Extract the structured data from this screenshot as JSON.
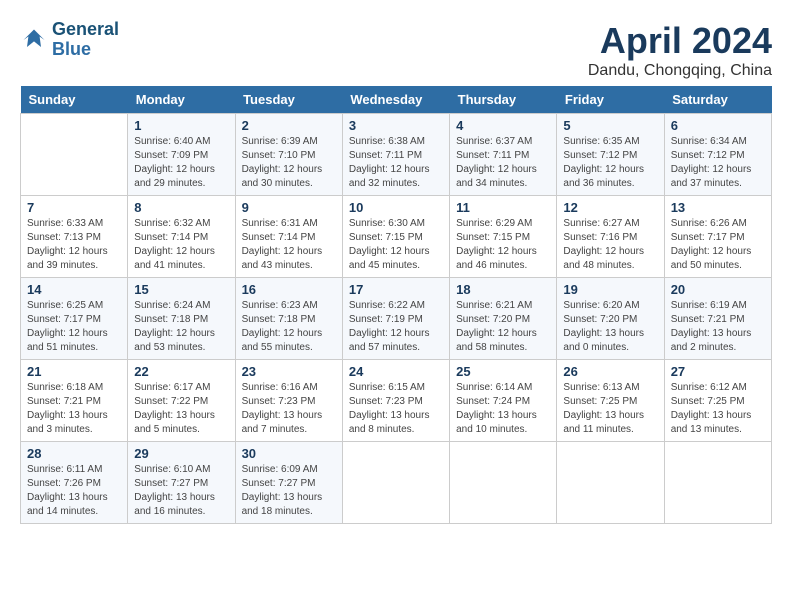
{
  "header": {
    "logo_line1": "General",
    "logo_line2": "Blue",
    "month_year": "April 2024",
    "location": "Dandu, Chongqing, China"
  },
  "weekdays": [
    "Sunday",
    "Monday",
    "Tuesday",
    "Wednesday",
    "Thursday",
    "Friday",
    "Saturday"
  ],
  "weeks": [
    [
      {
        "day": "",
        "sunrise": "",
        "sunset": "",
        "daylight": ""
      },
      {
        "day": "1",
        "sunrise": "Sunrise: 6:40 AM",
        "sunset": "Sunset: 7:09 PM",
        "daylight": "Daylight: 12 hours and 29 minutes."
      },
      {
        "day": "2",
        "sunrise": "Sunrise: 6:39 AM",
        "sunset": "Sunset: 7:10 PM",
        "daylight": "Daylight: 12 hours and 30 minutes."
      },
      {
        "day": "3",
        "sunrise": "Sunrise: 6:38 AM",
        "sunset": "Sunset: 7:11 PM",
        "daylight": "Daylight: 12 hours and 32 minutes."
      },
      {
        "day": "4",
        "sunrise": "Sunrise: 6:37 AM",
        "sunset": "Sunset: 7:11 PM",
        "daylight": "Daylight: 12 hours and 34 minutes."
      },
      {
        "day": "5",
        "sunrise": "Sunrise: 6:35 AM",
        "sunset": "Sunset: 7:12 PM",
        "daylight": "Daylight: 12 hours and 36 minutes."
      },
      {
        "day": "6",
        "sunrise": "Sunrise: 6:34 AM",
        "sunset": "Sunset: 7:12 PM",
        "daylight": "Daylight: 12 hours and 37 minutes."
      }
    ],
    [
      {
        "day": "7",
        "sunrise": "Sunrise: 6:33 AM",
        "sunset": "Sunset: 7:13 PM",
        "daylight": "Daylight: 12 hours and 39 minutes."
      },
      {
        "day": "8",
        "sunrise": "Sunrise: 6:32 AM",
        "sunset": "Sunset: 7:14 PM",
        "daylight": "Daylight: 12 hours and 41 minutes."
      },
      {
        "day": "9",
        "sunrise": "Sunrise: 6:31 AM",
        "sunset": "Sunset: 7:14 PM",
        "daylight": "Daylight: 12 hours and 43 minutes."
      },
      {
        "day": "10",
        "sunrise": "Sunrise: 6:30 AM",
        "sunset": "Sunset: 7:15 PM",
        "daylight": "Daylight: 12 hours and 45 minutes."
      },
      {
        "day": "11",
        "sunrise": "Sunrise: 6:29 AM",
        "sunset": "Sunset: 7:15 PM",
        "daylight": "Daylight: 12 hours and 46 minutes."
      },
      {
        "day": "12",
        "sunrise": "Sunrise: 6:27 AM",
        "sunset": "Sunset: 7:16 PM",
        "daylight": "Daylight: 12 hours and 48 minutes."
      },
      {
        "day": "13",
        "sunrise": "Sunrise: 6:26 AM",
        "sunset": "Sunset: 7:17 PM",
        "daylight": "Daylight: 12 hours and 50 minutes."
      }
    ],
    [
      {
        "day": "14",
        "sunrise": "Sunrise: 6:25 AM",
        "sunset": "Sunset: 7:17 PM",
        "daylight": "Daylight: 12 hours and 51 minutes."
      },
      {
        "day": "15",
        "sunrise": "Sunrise: 6:24 AM",
        "sunset": "Sunset: 7:18 PM",
        "daylight": "Daylight: 12 hours and 53 minutes."
      },
      {
        "day": "16",
        "sunrise": "Sunrise: 6:23 AM",
        "sunset": "Sunset: 7:18 PM",
        "daylight": "Daylight: 12 hours and 55 minutes."
      },
      {
        "day": "17",
        "sunrise": "Sunrise: 6:22 AM",
        "sunset": "Sunset: 7:19 PM",
        "daylight": "Daylight: 12 hours and 57 minutes."
      },
      {
        "day": "18",
        "sunrise": "Sunrise: 6:21 AM",
        "sunset": "Sunset: 7:20 PM",
        "daylight": "Daylight: 12 hours and 58 minutes."
      },
      {
        "day": "19",
        "sunrise": "Sunrise: 6:20 AM",
        "sunset": "Sunset: 7:20 PM",
        "daylight": "Daylight: 13 hours and 0 minutes."
      },
      {
        "day": "20",
        "sunrise": "Sunrise: 6:19 AM",
        "sunset": "Sunset: 7:21 PM",
        "daylight": "Daylight: 13 hours and 2 minutes."
      }
    ],
    [
      {
        "day": "21",
        "sunrise": "Sunrise: 6:18 AM",
        "sunset": "Sunset: 7:21 PM",
        "daylight": "Daylight: 13 hours and 3 minutes."
      },
      {
        "day": "22",
        "sunrise": "Sunrise: 6:17 AM",
        "sunset": "Sunset: 7:22 PM",
        "daylight": "Daylight: 13 hours and 5 minutes."
      },
      {
        "day": "23",
        "sunrise": "Sunrise: 6:16 AM",
        "sunset": "Sunset: 7:23 PM",
        "daylight": "Daylight: 13 hours and 7 minutes."
      },
      {
        "day": "24",
        "sunrise": "Sunrise: 6:15 AM",
        "sunset": "Sunset: 7:23 PM",
        "daylight": "Daylight: 13 hours and 8 minutes."
      },
      {
        "day": "25",
        "sunrise": "Sunrise: 6:14 AM",
        "sunset": "Sunset: 7:24 PM",
        "daylight": "Daylight: 13 hours and 10 minutes."
      },
      {
        "day": "26",
        "sunrise": "Sunrise: 6:13 AM",
        "sunset": "Sunset: 7:25 PM",
        "daylight": "Daylight: 13 hours and 11 minutes."
      },
      {
        "day": "27",
        "sunrise": "Sunrise: 6:12 AM",
        "sunset": "Sunset: 7:25 PM",
        "daylight": "Daylight: 13 hours and 13 minutes."
      }
    ],
    [
      {
        "day": "28",
        "sunrise": "Sunrise: 6:11 AM",
        "sunset": "Sunset: 7:26 PM",
        "daylight": "Daylight: 13 hours and 14 minutes."
      },
      {
        "day": "29",
        "sunrise": "Sunrise: 6:10 AM",
        "sunset": "Sunset: 7:27 PM",
        "daylight": "Daylight: 13 hours and 16 minutes."
      },
      {
        "day": "30",
        "sunrise": "Sunrise: 6:09 AM",
        "sunset": "Sunset: 7:27 PM",
        "daylight": "Daylight: 13 hours and 18 minutes."
      },
      {
        "day": "",
        "sunrise": "",
        "sunset": "",
        "daylight": ""
      },
      {
        "day": "",
        "sunrise": "",
        "sunset": "",
        "daylight": ""
      },
      {
        "day": "",
        "sunrise": "",
        "sunset": "",
        "daylight": ""
      },
      {
        "day": "",
        "sunrise": "",
        "sunset": "",
        "daylight": ""
      }
    ]
  ]
}
